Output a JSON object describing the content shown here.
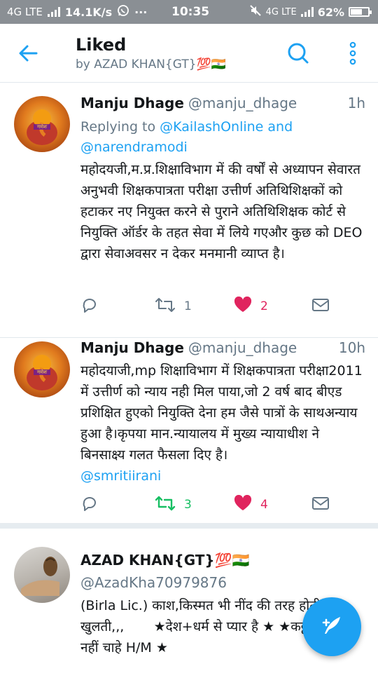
{
  "status_bar": {
    "network": "4G LTE",
    "speed": "14.1K/s",
    "dots": "···",
    "time": "10:35",
    "network_right": "4G LTE",
    "battery": "62%",
    "battery_level": 0.62
  },
  "header": {
    "title": "Liked",
    "subtitle": "by AZAD KHAN{GT}💯🇮🇳",
    "icons": [
      "back-arrow-icon",
      "search-icon",
      "more-vertical-icon"
    ],
    "accent_color": "#1da1f2"
  },
  "tweets": [
    {
      "name": "Manju Dhage",
      "handle": "@manju_dhage",
      "time": "1h",
      "replying_prefix": "Replying to ",
      "replying_to_1": "@KailashOnline and",
      "replying_to_2": "@narendramodi",
      "text": "महोदयजी,म.प्र.शिक्षाविभाग में की वर्षों से अध्यापन सेवारत अनुभवी शिक्षकपात्रता परीक्षा उत्तीर्ण अतिथिशिक्षकों को हटाकर नए नियुक्त करने से पुराने अतिथिशिक्षक कोर्ट से नियुक्ति ऑर्डर के तहत सेवा में लिये गएऔर कुछ को DEO द्वारा सेवाअवसर न देकर मनमानी व्याप्त है।",
      "retweets": "1",
      "likes": "2"
    },
    {
      "name": "Manju Dhage",
      "handle": "@manju_dhage",
      "time": "10h",
      "text": "महोदयाजी,mp शिक्षाविभाग में शिक्षकपात्रता परीक्षा2011 में उत्तीर्ण को न्याय नही मिल पाया,जो 2 वर्ष बाद बीएड प्रशिक्षित हुएको नियुक्ति देना हम जैसे पात्रों के साथअन्याय हुआ है।कृपया मान.न्यायालय में मुख्य न्यायाधीश ने बिनसाक्ष्य गलत फैसला दिए है।",
      "mention": "@smritiirani",
      "retweets": "3",
      "likes": "4"
    },
    {
      "name": "AZAD KHAN{GT}💯🇮🇳",
      "handle": "@AzadKha70979876",
      "text": "(Birla Lic.) काश,किस्मत भी नींद की तरह होती, खुलती,,,       ★देश+धर्म से प्यार है ★ ★कट्टरवादीयों से नहीं चाहे H/M ★"
    }
  ],
  "colors": {
    "like_red": "#e0245e",
    "retweet_green": "#17bf63",
    "muted": "#657786",
    "link": "#1da1f2"
  },
  "fab": {
    "icon": "compose-feather-icon"
  }
}
